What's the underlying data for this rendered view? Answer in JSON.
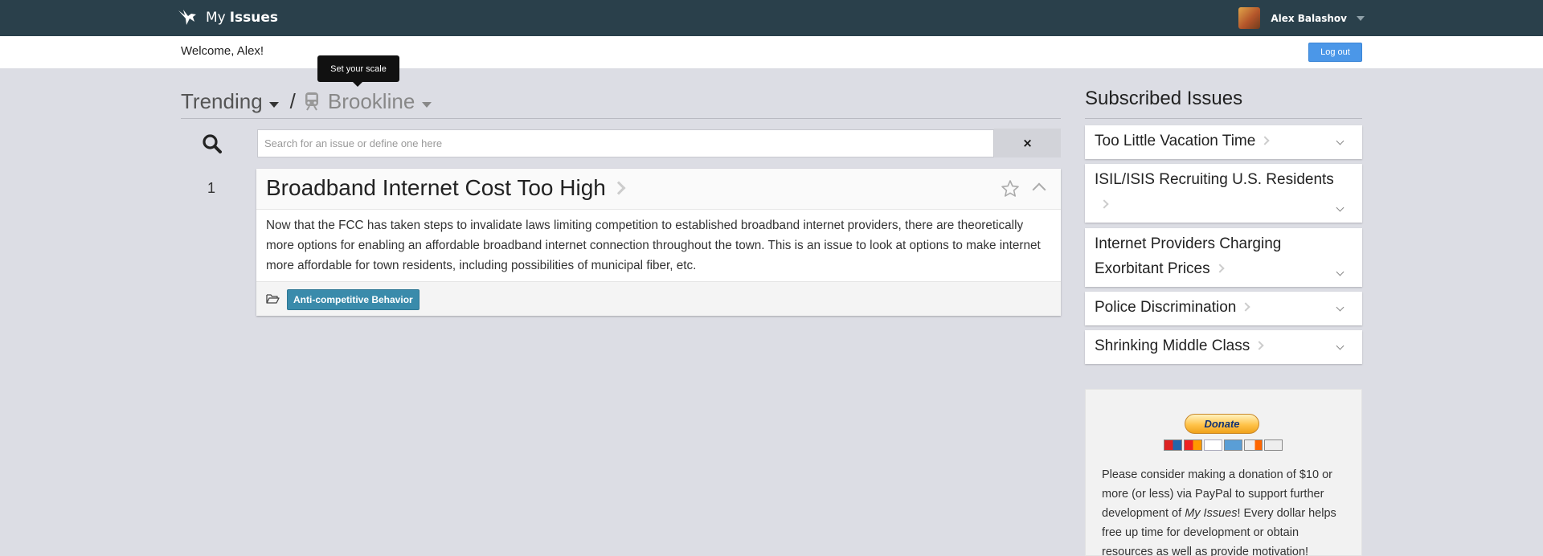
{
  "header": {
    "brand_my": "My",
    "brand_issues": "Issues",
    "user_name": "Alex Balashov"
  },
  "welcome": {
    "text": "Welcome, Alex!",
    "logout_label": "Log out"
  },
  "tooltip": "Set your scale",
  "scope": {
    "trend_label": "Trending",
    "separator": "/",
    "town": "Brookline"
  },
  "search": {
    "placeholder": "Search for an issue or define one here",
    "value": "",
    "clear_label": "×"
  },
  "issue": {
    "rank": "1",
    "title": "Broadband Internet Cost Too High",
    "body": "Now that the FCC has taken steps to invalidate laws limiting competition to established broadband internet providers, there are theoretically more options for enabling an affordable broadband internet connection throughout the town. This is an issue to look at options to make internet more affordable for town residents, including possibilities of municipal fiber, etc.",
    "tag": "Anti-competitive Behavior"
  },
  "subscribed": {
    "title": "Subscribed Issues",
    "items": [
      {
        "label": "Too Little Vacation Time"
      },
      {
        "label": "ISIL/ISIS Recruiting U.S. Residents"
      },
      {
        "label": "Internet Providers Charging Exorbitant Prices"
      },
      {
        "label": "Police Discrimination"
      },
      {
        "label": "Shrinking Middle Class"
      }
    ]
  },
  "donate": {
    "button_label": "Donate",
    "text_before": "Please consider making a donation of $10 or more (or less) via PayPal to support further development of ",
    "text_emph": "My Issues",
    "text_after": "! Every dollar helps free up time for development or obtain resources as well as provide motivation!",
    "card_icons": [
      "maestro-icon",
      "mastercard-icon",
      "visa-icon",
      "amex-icon",
      "discover-icon",
      "bank-icon"
    ]
  },
  "colors": {
    "topbar": "#2a404b",
    "accent_button": "#4b97e8",
    "tag": "#3a8bab",
    "background": "#dcdde4"
  }
}
